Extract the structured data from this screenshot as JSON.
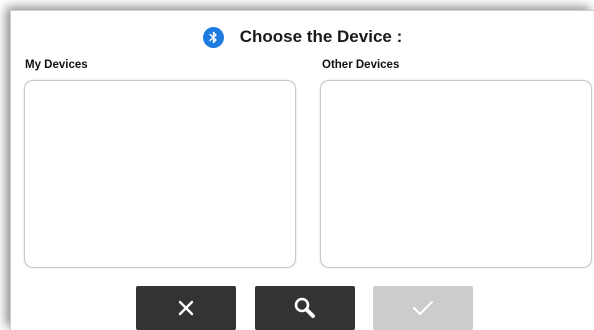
{
  "dialog": {
    "title": "Choose the Device :",
    "title_icon": "bluetooth-icon",
    "my_devices_label": "My Devices",
    "other_devices_label": "Other Devices",
    "my_devices": [],
    "other_devices": []
  },
  "buttons": {
    "cancel_icon": "close-icon",
    "search_icon": "search-icon",
    "confirm_icon": "checkmark-icon",
    "confirm_enabled": false
  },
  "colors": {
    "accent": "#1f7ae0",
    "button_dark": "#333333",
    "button_disabled": "#cccccc"
  }
}
